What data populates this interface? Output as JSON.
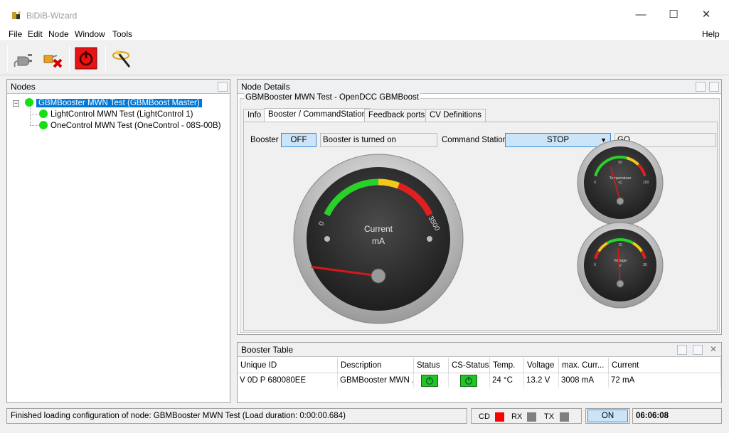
{
  "app": {
    "title": "BiDiB-Wizard"
  },
  "window_controls": {
    "minimize": "—",
    "maximize": "☐",
    "close": "✕"
  },
  "menu": {
    "file": "File",
    "edit": "Edit",
    "node": "Node",
    "window": "Window",
    "tools": "Tools",
    "help": "Help"
  },
  "toolbar": {
    "icons": [
      "plug-icon",
      "disconnect-icon",
      "power-off-icon",
      "magic-wand-icon"
    ]
  },
  "nodes_panel": {
    "title": "Nodes",
    "tree": [
      {
        "label": "GBMBooster MWN Test (GBMBoost Master)",
        "expander": "−",
        "status_color": "#14e014"
      },
      {
        "label": "LightControl MWN Test (LightControl 1)",
        "status_color": "#14e014"
      },
      {
        "label": "OneControl MWN Test (OneControl - 08S-00B)",
        "status_color": "#14e014"
      }
    ]
  },
  "details_panel": {
    "title": "Node Details",
    "group_title": "GBMBooster MWN Test - OpenDCC GBMBoost",
    "tabs": [
      "Info",
      "Booster / CommandStation",
      "Feedback ports",
      "CV Definitions"
    ],
    "active_tab": 1,
    "booster_label": "Booster",
    "booster_button": "OFF",
    "booster_status": "Booster is turned on",
    "cs_label": "Command Station",
    "cs_select": "STOP",
    "cs_status": "GO",
    "gauges": {
      "current": {
        "label": "Current",
        "unit": "mA",
        "min": "0",
        "max": "3500",
        "value_fraction": 0.02
      },
      "temperature": {
        "label": "Temperature",
        "unit": "°C",
        "min": "0",
        "mid": "50",
        "max": "100",
        "value_fraction": 0.24
      },
      "voltage": {
        "label": "Voltage",
        "unit": "V",
        "min": "0",
        "mid": "15",
        "max": "30",
        "value_fraction": 0.44
      }
    }
  },
  "booster_table": {
    "title": "Booster Table",
    "columns": [
      "Unique ID",
      "Description",
      "Status",
      "CS-Status",
      "Temp.",
      "Voltage",
      "max. Curr...",
      "Current"
    ],
    "rows": [
      {
        "unique_id": "V 0D P 680080EE",
        "description": "GBMBooster MWN ...",
        "temp": "24 °C",
        "voltage": "13.2 V",
        "max_current": "3008 mA",
        "current": "72 mA"
      }
    ]
  },
  "statusbar": {
    "message": "Finished loading configuration of node: GBMBooster MWN Test (Load duration: 0:00:00.684)",
    "cd": "CD",
    "rx": "RX",
    "tx": "TX",
    "cd_color": "#ff0000",
    "rx_color": "#808080",
    "tx_color": "#808080",
    "on_button": "ON",
    "time": "06:06:08"
  }
}
